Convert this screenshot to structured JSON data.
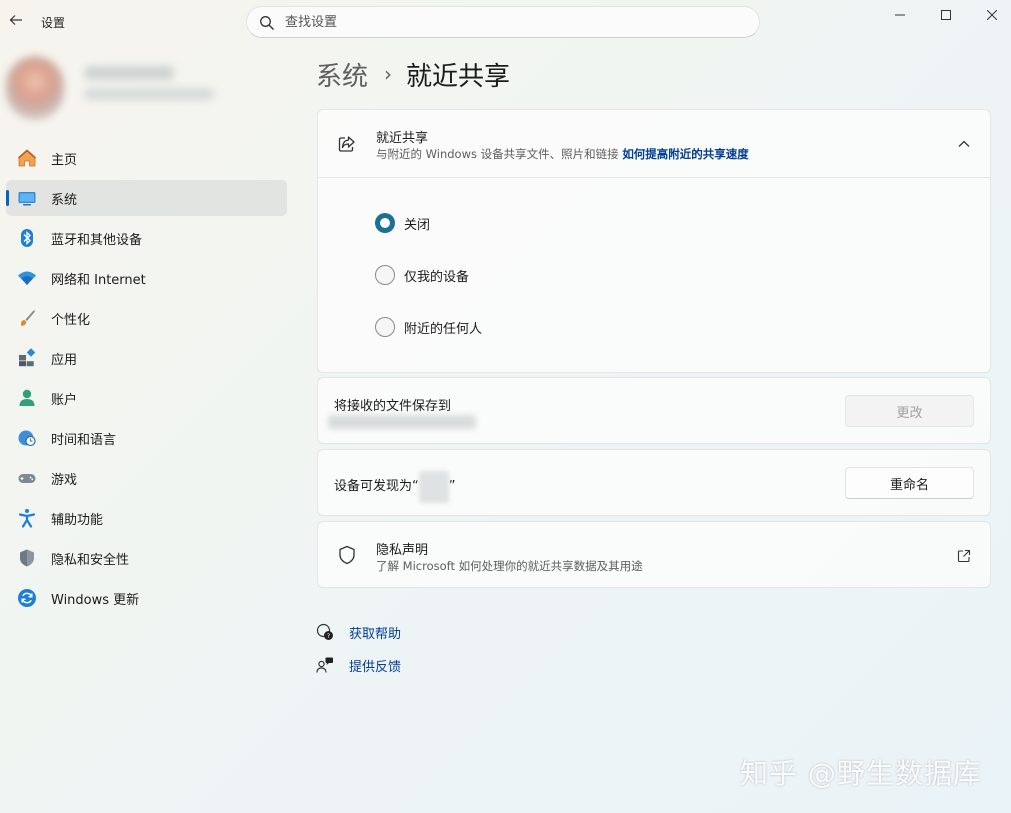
{
  "app": {
    "title": "设置",
    "back_icon": "arrow-left-icon"
  },
  "search": {
    "placeholder": "查找设置"
  },
  "window_controls": [
    "minimize-icon",
    "maximize-icon",
    "close-icon"
  ],
  "nav": {
    "items": [
      {
        "label": "主页",
        "icon": "home-icon",
        "selected": false
      },
      {
        "label": "系统",
        "icon": "system-display-icon",
        "selected": true
      },
      {
        "label": "蓝牙和其他设备",
        "icon": "bluetooth-icon",
        "selected": false
      },
      {
        "label": "网络和 Internet",
        "icon": "wifi-icon",
        "selected": false
      },
      {
        "label": "个性化",
        "icon": "brush-icon",
        "selected": false
      },
      {
        "label": "应用",
        "icon": "apps-icon",
        "selected": false
      },
      {
        "label": "账户",
        "icon": "account-icon",
        "selected": false
      },
      {
        "label": "时间和语言",
        "icon": "globe-clock-icon",
        "selected": false
      },
      {
        "label": "游戏",
        "icon": "gamepad-icon",
        "selected": false
      },
      {
        "label": "辅助功能",
        "icon": "accessibility-icon",
        "selected": false
      },
      {
        "label": "隐私和安全性",
        "icon": "shield-icon",
        "selected": false
      },
      {
        "label": "Windows 更新",
        "icon": "update-icon",
        "selected": false
      }
    ]
  },
  "breadcrumb": {
    "parent": "系统",
    "separator": "›",
    "current": "就近共享"
  },
  "nearby_sharing": {
    "title": "就近共享",
    "subtitle": "与附近的 Windows 设备共享文件、照片和链接",
    "link": "如何提高附近的共享速度",
    "options": [
      {
        "label": "关闭",
        "checked": true
      },
      {
        "label": "仅我的设备",
        "checked": false
      },
      {
        "label": "附近的任何人",
        "checked": false
      }
    ]
  },
  "save_location": {
    "title": "将接收的文件保存到",
    "button": "更改"
  },
  "discoverable": {
    "title": "设备可发现为“",
    "title_end": "”",
    "button": "重命名"
  },
  "privacy": {
    "title": "隐私声明",
    "subtitle": "了解 Microsoft 如何处理你的就近共享数据及其用途"
  },
  "help": {
    "get_help": "获取帮助",
    "feedback": "提供反馈"
  },
  "watermark": "知乎 @野生数据库",
  "colors": {
    "accent": "#0067c0",
    "radio_checked": "#1c6f96",
    "link": "#003e92"
  }
}
